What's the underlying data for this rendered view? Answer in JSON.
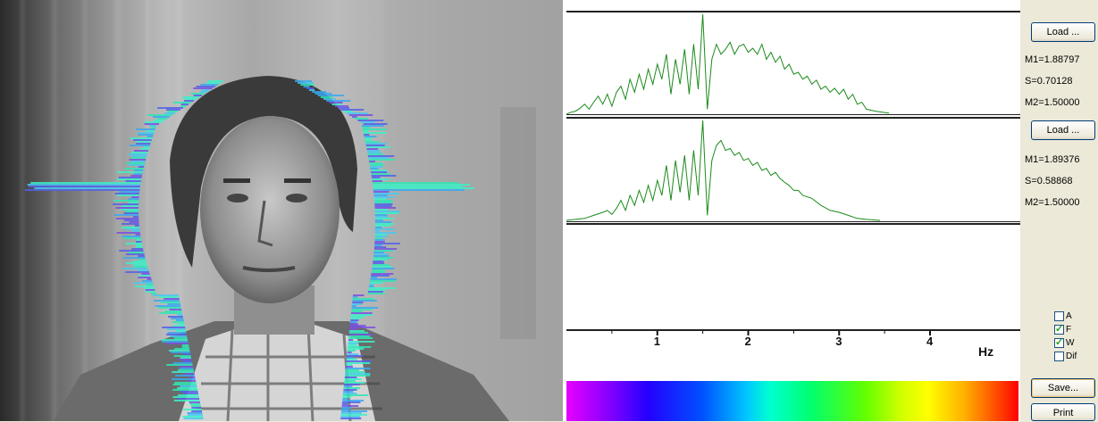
{
  "spectra": {
    "panels": [
      {
        "trace": [
          [
            0,
            0
          ],
          [
            0.05,
            0.02
          ],
          [
            0.1,
            0.03
          ],
          [
            0.15,
            0.06
          ],
          [
            0.2,
            0.1
          ],
          [
            0.25,
            0.05
          ],
          [
            0.3,
            0.12
          ],
          [
            0.35,
            0.18
          ],
          [
            0.4,
            0.1
          ],
          [
            0.45,
            0.2
          ],
          [
            0.5,
            0.08
          ],
          [
            0.55,
            0.22
          ],
          [
            0.6,
            0.28
          ],
          [
            0.65,
            0.15
          ],
          [
            0.7,
            0.35
          ],
          [
            0.75,
            0.22
          ],
          [
            0.8,
            0.4
          ],
          [
            0.85,
            0.25
          ],
          [
            0.9,
            0.45
          ],
          [
            0.95,
            0.3
          ],
          [
            1.0,
            0.5
          ],
          [
            1.05,
            0.35
          ],
          [
            1.1,
            0.6
          ],
          [
            1.15,
            0.2
          ],
          [
            1.2,
            0.55
          ],
          [
            1.25,
            0.3
          ],
          [
            1.3,
            0.65
          ],
          [
            1.35,
            0.2
          ],
          [
            1.4,
            0.7
          ],
          [
            1.45,
            0.25
          ],
          [
            1.5,
            1.0
          ],
          [
            1.55,
            0.05
          ],
          [
            1.6,
            0.55
          ],
          [
            1.65,
            0.7
          ],
          [
            1.7,
            0.6
          ],
          [
            1.75,
            0.65
          ],
          [
            1.8,
            0.72
          ],
          [
            1.85,
            0.6
          ],
          [
            1.9,
            0.68
          ],
          [
            1.95,
            0.7
          ],
          [
            2.0,
            0.62
          ],
          [
            2.05,
            0.66
          ],
          [
            2.1,
            0.6
          ],
          [
            2.15,
            0.7
          ],
          [
            2.2,
            0.55
          ],
          [
            2.25,
            0.62
          ],
          [
            2.3,
            0.52
          ],
          [
            2.35,
            0.58
          ],
          [
            2.4,
            0.45
          ],
          [
            2.45,
            0.5
          ],
          [
            2.5,
            0.4
          ],
          [
            2.55,
            0.42
          ],
          [
            2.6,
            0.35
          ],
          [
            2.65,
            0.38
          ],
          [
            2.7,
            0.3
          ],
          [
            2.75,
            0.34
          ],
          [
            2.8,
            0.25
          ],
          [
            2.85,
            0.28
          ],
          [
            2.9,
            0.22
          ],
          [
            2.95,
            0.26
          ],
          [
            3.0,
            0.2
          ],
          [
            3.05,
            0.25
          ],
          [
            3.1,
            0.15
          ],
          [
            3.15,
            0.2
          ],
          [
            3.2,
            0.1
          ],
          [
            3.25,
            0.12
          ],
          [
            3.3,
            0.05
          ],
          [
            3.4,
            0.03
          ],
          [
            3.55,
            0.01
          ]
        ]
      },
      {
        "trace": [
          [
            0,
            0
          ],
          [
            0.1,
            0.01
          ],
          [
            0.2,
            0.02
          ],
          [
            0.3,
            0.05
          ],
          [
            0.4,
            0.08
          ],
          [
            0.45,
            0.1
          ],
          [
            0.5,
            0.06
          ],
          [
            0.55,
            0.12
          ],
          [
            0.6,
            0.2
          ],
          [
            0.65,
            0.1
          ],
          [
            0.7,
            0.25
          ],
          [
            0.75,
            0.15
          ],
          [
            0.8,
            0.3
          ],
          [
            0.85,
            0.18
          ],
          [
            0.9,
            0.35
          ],
          [
            0.95,
            0.2
          ],
          [
            1.0,
            0.4
          ],
          [
            1.05,
            0.25
          ],
          [
            1.1,
            0.55
          ],
          [
            1.15,
            0.2
          ],
          [
            1.2,
            0.6
          ],
          [
            1.25,
            0.28
          ],
          [
            1.3,
            0.65
          ],
          [
            1.35,
            0.2
          ],
          [
            1.4,
            0.7
          ],
          [
            1.45,
            0.25
          ],
          [
            1.5,
            1.0
          ],
          [
            1.55,
            0.05
          ],
          [
            1.6,
            0.6
          ],
          [
            1.65,
            0.75
          ],
          [
            1.7,
            0.8
          ],
          [
            1.75,
            0.7
          ],
          [
            1.8,
            0.72
          ],
          [
            1.85,
            0.65
          ],
          [
            1.9,
            0.68
          ],
          [
            1.95,
            0.6
          ],
          [
            2.0,
            0.62
          ],
          [
            2.05,
            0.55
          ],
          [
            2.1,
            0.58
          ],
          [
            2.15,
            0.5
          ],
          [
            2.2,
            0.52
          ],
          [
            2.25,
            0.45
          ],
          [
            2.3,
            0.48
          ],
          [
            2.35,
            0.42
          ],
          [
            2.4,
            0.38
          ],
          [
            2.45,
            0.35
          ],
          [
            2.5,
            0.3
          ],
          [
            2.55,
            0.3
          ],
          [
            2.6,
            0.25
          ],
          [
            2.7,
            0.22
          ],
          [
            2.8,
            0.15
          ],
          [
            2.9,
            0.1
          ],
          [
            3.0,
            0.08
          ],
          [
            3.1,
            0.05
          ],
          [
            3.2,
            0.02
          ],
          [
            3.3,
            0.01
          ],
          [
            3.45,
            0.0
          ]
        ]
      }
    ],
    "axis": {
      "ticks": [
        "1",
        "2",
        "3",
        "4"
      ],
      "unit": "Hz"
    },
    "trace_color": "#1a8a1a"
  },
  "controls": {
    "load1_label": "Load ...",
    "load2_label": "Load ...",
    "m1_a": "M1=1.88797",
    "s_a": "S=0.70128",
    "m2_a": "M2=1.50000",
    "m1_b": "M1=1.89376",
    "s_b": "S=0.58868",
    "m2_b": "M2=1.50000",
    "checkboxes": [
      {
        "label": "A",
        "checked": false
      },
      {
        "label": "F",
        "checked": true
      },
      {
        "label": "W",
        "checked": true
      },
      {
        "label": "Dif",
        "checked": false
      }
    ],
    "save_label": "Save...",
    "print_label": "Print"
  }
}
